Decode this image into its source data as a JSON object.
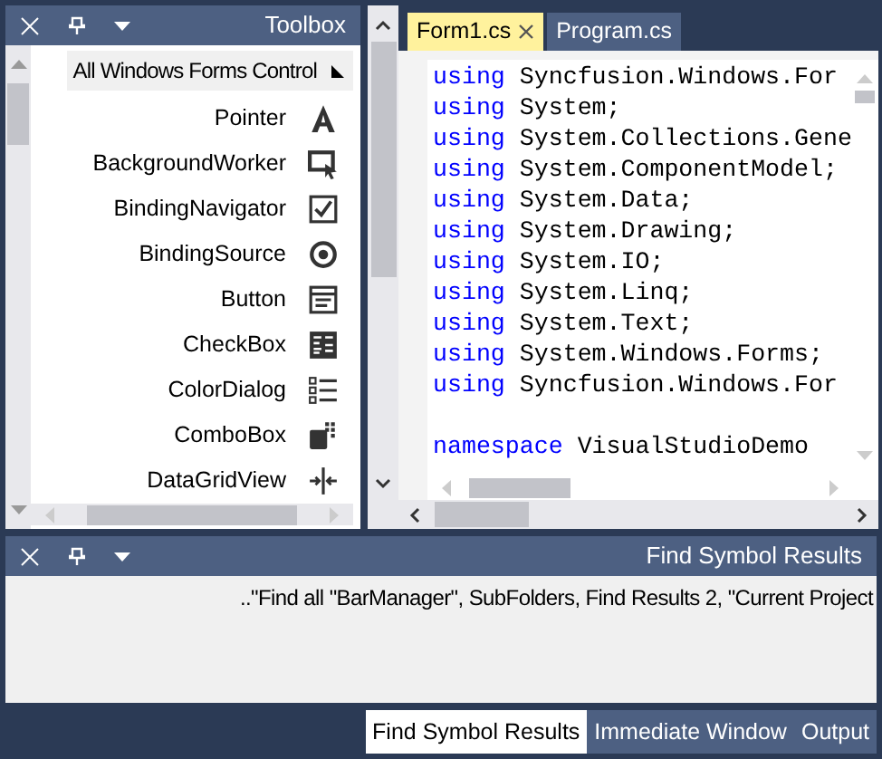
{
  "toolbox": {
    "title": "Toolbox",
    "category": {
      "label": "All Windows Forms Control",
      "expanded": false
    },
    "items": [
      {
        "label": "Pointer"
      },
      {
        "label": "BackgroundWorker"
      },
      {
        "label": "BindingNavigator"
      },
      {
        "label": "BindingSource"
      },
      {
        "label": "Button"
      },
      {
        "label": "CheckBox"
      },
      {
        "label": "ColorDialog"
      },
      {
        "label": "ComboBox"
      },
      {
        "label": "DataGridView"
      }
    ]
  },
  "editor": {
    "tabs": [
      {
        "label": "Form1.cs",
        "selected": true,
        "closable": true
      },
      {
        "label": "Program.cs",
        "selected": false,
        "closable": false
      }
    ],
    "code_blocks": [
      {
        "lines": [
          {
            "keyword": "using",
            "text": "Syncfusion.Windows.For"
          },
          {
            "keyword": "using",
            "text": "System;"
          },
          {
            "keyword": "using",
            "text": "System.Collections.Gene"
          },
          {
            "keyword": "using",
            "text": "System.ComponentModel;"
          },
          {
            "keyword": "using",
            "text": "System.Data;"
          },
          {
            "keyword": "using",
            "text": "System.Drawing;"
          },
          {
            "keyword": "using",
            "text": "System.IO;"
          },
          {
            "keyword": "using",
            "text": "System.Linq;"
          },
          {
            "keyword": "using",
            "text": "System.Text;"
          },
          {
            "keyword": "using",
            "text": "System.Windows.Forms;"
          },
          {
            "keyword": "using",
            "text": "Syncfusion.Windows.For"
          }
        ]
      },
      {
        "lines": [
          {
            "keyword": "namespace",
            "text": "VisualStudioDemo"
          }
        ]
      }
    ]
  },
  "results_panel": {
    "title": "Find Symbol Results",
    "message": "..\"Find all \"BarManager\", SubFolders, Find Results 2, \"Current Project"
  },
  "bottom_tabs": [
    {
      "label": "Find Symbol Results",
      "selected": true
    },
    {
      "label": "Immediate Window",
      "selected": false
    },
    {
      "label": "Output",
      "selected": false
    }
  ]
}
